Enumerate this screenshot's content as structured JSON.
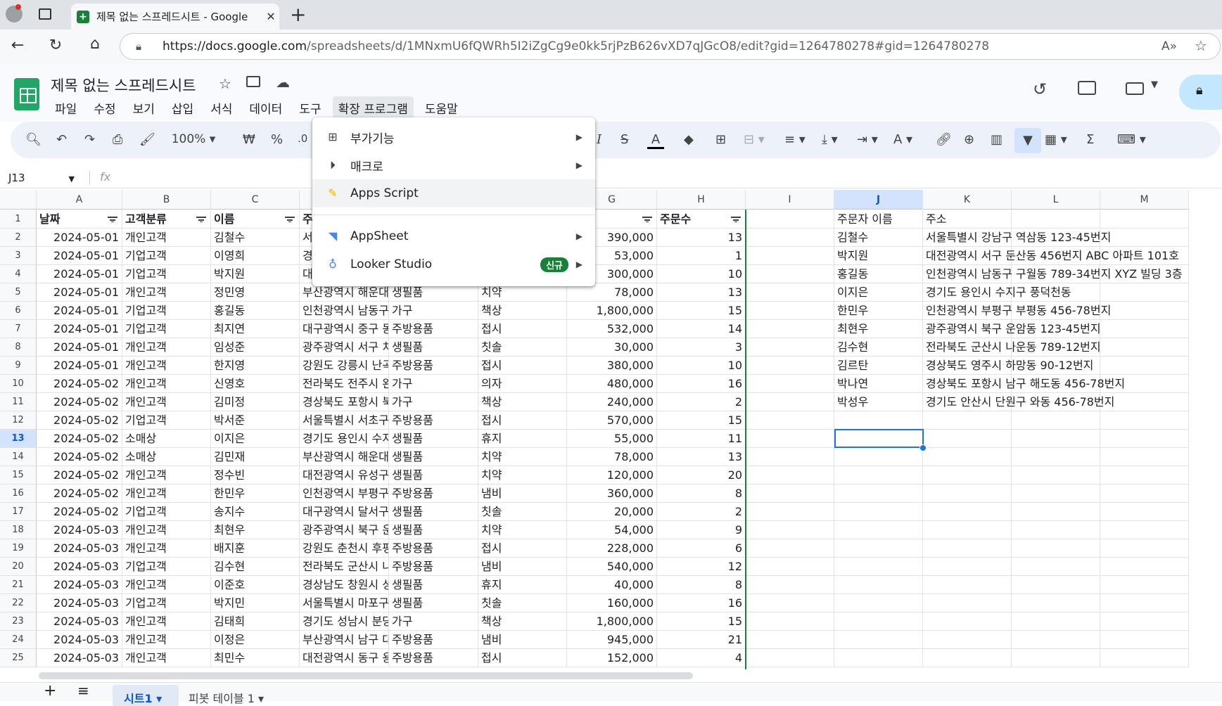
{
  "browser": {
    "tab_title": "제목 없는 스프레드시트 - Google",
    "url_domain": "https://docs.google.com",
    "url_path": "/spreadsheets/d/1MNxmU6fQWRh5I2iZgCg9e0kk5rjPzB626vXD7qJGcO8/edit?gid=1264780278#gid=1264780278"
  },
  "doc": {
    "title": "제목 없는 스프레드시트",
    "menus": [
      "파일",
      "수정",
      "보기",
      "삽입",
      "서식",
      "데이터",
      "도구",
      "확장 프로그램",
      "도움말"
    ],
    "active_menu": "확장 프로그램"
  },
  "toolbar": {
    "zoom": "100%",
    "currency": "₩",
    "percent": "%",
    "decimal": ".0"
  },
  "formula_bar": {
    "name_box": "J13",
    "fx": "fx"
  },
  "extensions_menu": {
    "items": [
      {
        "label": "부가기능",
        "icon": "addons-icon",
        "submenu": true
      },
      {
        "label": "매크로",
        "icon": "macro-play-icon",
        "submenu": true
      },
      {
        "label": "Apps Script",
        "icon": "apps-script-icon",
        "submenu": false,
        "highlight": true
      },
      {
        "label": "AppSheet",
        "icon": "appsheet-icon",
        "submenu": true
      },
      {
        "label": "Looker Studio",
        "icon": "looker-studio-icon",
        "submenu": true,
        "badge": "신규"
      }
    ]
  },
  "columns": [
    "A",
    "B",
    "C",
    "D",
    "E",
    "F",
    "G",
    "H",
    "I",
    "J",
    "K",
    "L",
    "M"
  ],
  "row_numbers": [
    1,
    2,
    3,
    4,
    5,
    6,
    7,
    8,
    9,
    10,
    11,
    12,
    13,
    14,
    15,
    16,
    17,
    18,
    19,
    20,
    21,
    22,
    23,
    24,
    25
  ],
  "header_row": {
    "A": "날짜",
    "B": "고객분류",
    "C": "이름",
    "D": "주",
    "H": "주문수",
    "J": "주문자 이름",
    "K": "주소"
  },
  "rows": [
    [
      "2024-05-01",
      "개인고객",
      "김철수",
      "서",
      "",
      "",
      "390,000",
      "13"
    ],
    [
      "2024-05-01",
      "기업고객",
      "이영희",
      "경",
      "",
      "",
      "53,000",
      "1"
    ],
    [
      "2024-05-01",
      "기업고객",
      "박지원",
      "대",
      "",
      "",
      "300,000",
      "10"
    ],
    [
      "2024-05-01",
      "개인고객",
      "정민영",
      "부산광역시 해운대",
      "생필품",
      "치약",
      "78,000",
      "13"
    ],
    [
      "2024-05-01",
      "기업고객",
      "홍길동",
      "인천광역시 남동구",
      "가구",
      "책상",
      "1,800,000",
      "15"
    ],
    [
      "2024-05-01",
      "기업고객",
      "최지연",
      "대구광역시 중구 동",
      "주방용품",
      "접시",
      "532,000",
      "14"
    ],
    [
      "2024-05-01",
      "개인고객",
      "임성준",
      "광주광역시 서구 치",
      "생필품",
      "칫솔",
      "30,000",
      "3"
    ],
    [
      "2024-05-01",
      "개인고객",
      "한지영",
      "강원도 강릉시 난곡",
      "주방용품",
      "접시",
      "380,000",
      "10"
    ],
    [
      "2024-05-02",
      "개인고객",
      "신영호",
      "전라북도 전주시 완",
      "가구",
      "의자",
      "480,000",
      "16"
    ],
    [
      "2024-05-02",
      "개인고객",
      "김미정",
      "경상북도 포항시 북",
      "가구",
      "책상",
      "240,000",
      "2"
    ],
    [
      "2024-05-02",
      "기업고객",
      "박서준",
      "서울특별시 서초구",
      "주방용품",
      "접시",
      "570,000",
      "15"
    ],
    [
      "2024-05-02",
      "소매상",
      "이지은",
      "경기도 용인시 수지",
      "생필품",
      "휴지",
      "55,000",
      "11"
    ],
    [
      "2024-05-02",
      "소매상",
      "김민재",
      "부산광역시 해운대",
      "생필품",
      "치약",
      "78,000",
      "13"
    ],
    [
      "2024-05-02",
      "개인고객",
      "정수빈",
      "대전광역시 유성구",
      "생필품",
      "치약",
      "120,000",
      "20"
    ],
    [
      "2024-05-02",
      "개인고객",
      "한민우",
      "인천광역시 부평구",
      "주방용품",
      "냄비",
      "360,000",
      "8"
    ],
    [
      "2024-05-02",
      "기업고객",
      "송지수",
      "대구광역시 달서구",
      "생필품",
      "칫솔",
      "20,000",
      "2"
    ],
    [
      "2024-05-03",
      "개인고객",
      "최현우",
      "광주광역시 북구 운",
      "생필품",
      "치약",
      "54,000",
      "9"
    ],
    [
      "2024-05-03",
      "개인고객",
      "배지훈",
      "강원도 춘천시 후평",
      "주방용품",
      "접시",
      "228,000",
      "6"
    ],
    [
      "2024-05-03",
      "기업고객",
      "김수현",
      "전라북도 군산시 나",
      "주방용품",
      "냄비",
      "540,000",
      "12"
    ],
    [
      "2024-05-03",
      "개인고객",
      "이준호",
      "경상남도 창원시 성",
      "생필품",
      "휴지",
      "40,000",
      "8"
    ],
    [
      "2024-05-03",
      "기업고객",
      "박지민",
      "서울특별시 마포구",
      "생필품",
      "칫솔",
      "160,000",
      "16"
    ],
    [
      "2024-05-03",
      "개인고객",
      "김태희",
      "경기도 성남시 분당",
      "가구",
      "책상",
      "1,800,000",
      "15"
    ],
    [
      "2024-05-03",
      "개인고객",
      "이정은",
      "부산광역시 남구 대",
      "주방용품",
      "냄비",
      "945,000",
      "21"
    ],
    [
      "2024-05-03",
      "개인고객",
      "최민수",
      "대전광역시 동구 용",
      "주방용품",
      "접시",
      "152,000",
      "4"
    ]
  ],
  "side_table": [
    [
      "김철수",
      "서울특별시 강남구 역삼동 123-45번지"
    ],
    [
      "박지원",
      "대전광역시 서구 둔산동 456번지 ABC 아파트 101호"
    ],
    [
      "홍길동",
      "인천광역시 남동구 구월동 789-34번지 XYZ 빌딩 3층"
    ],
    [
      "이지은",
      "경기도 용인시 수지구 풍덕천동"
    ],
    [
      "한민우",
      "인천광역시 부평구 부평동 456-78번지"
    ],
    [
      "최현우",
      "광주광역시 북구 운암동 123-45번지"
    ],
    [
      "김수현",
      "전라북도 군산시 나운동 789-12번지"
    ],
    [
      "김르탄",
      "경상북도 영주시 하망동 90-12번지"
    ],
    [
      "박나연",
      "경상북도 포항시 남구 해도동 456-78번지"
    ],
    [
      "박성우",
      "경기도 안산시 단원구 와동 456-78번지"
    ]
  ],
  "selected_cell": "J13",
  "sheets": [
    "시트1",
    "피봇 테이블 1"
  ]
}
